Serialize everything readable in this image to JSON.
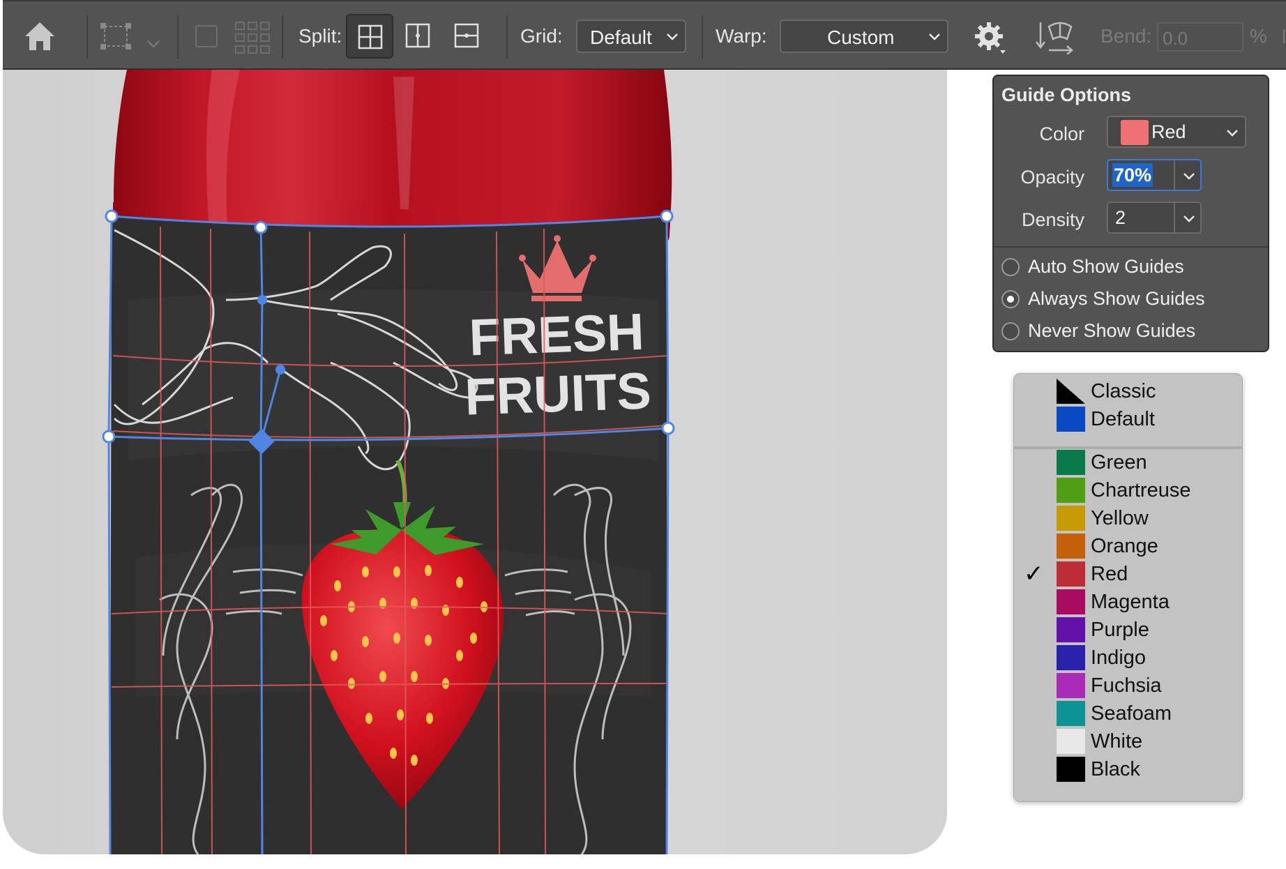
{
  "toolbar": {
    "split_label": "Split:",
    "grid_label": "Grid:",
    "grid_value": "Default",
    "warp_label": "Warp:",
    "warp_value": "Custom",
    "bend_label": "Bend:",
    "bend_value": "0.0",
    "bend_unit": "%",
    "icons": [
      "home-icon",
      "transform-icon",
      "chevron-down-icon",
      "square-icon",
      "grid-dots-icon",
      "split-crosswise-icon",
      "split-vertical-icon",
      "split-horizontal-icon",
      "gear-icon",
      "warp-orientation-icon"
    ]
  },
  "artwork": {
    "label_line1": "FRESH",
    "label_line2": "FRUITS"
  },
  "guide_options": {
    "title": "Guide Options",
    "color_label": "Color",
    "color_value": "Red",
    "color_swatch": "#f07173",
    "opacity_label": "Opacity",
    "opacity_value": "70%",
    "density_label": "Density",
    "density_value": "2",
    "radios": [
      {
        "label": "Auto Show Guides",
        "selected": false
      },
      {
        "label": "Always Show Guides",
        "selected": true
      },
      {
        "label": "Never Show Guides",
        "selected": false
      }
    ]
  },
  "color_menu": {
    "items": [
      {
        "label": "Classic",
        "color": "#000000"
      },
      {
        "label": "Default",
        "color": "#0a49c4"
      },
      {
        "label": "Green",
        "color": "#0a7a4c"
      },
      {
        "label": "Chartreuse",
        "color": "#4f9e14"
      },
      {
        "label": "Yellow",
        "color": "#c69a05"
      },
      {
        "label": "Orange",
        "color": "#c5600a"
      },
      {
        "label": "Red",
        "color": "#be2c35",
        "checked": true
      },
      {
        "label": "Magenta",
        "color": "#a80b5f"
      },
      {
        "label": "Purple",
        "color": "#6212a8"
      },
      {
        "label": "Indigo",
        "color": "#2a22ac"
      },
      {
        "label": "Fuchsia",
        "color": "#ac2ab8"
      },
      {
        "label": "Seafoam",
        "color": "#0d9395"
      },
      {
        "label": "White",
        "color": "#e8e8e8"
      },
      {
        "label": "Black",
        "color": "#000000"
      }
    ],
    "check_glyph": "✓"
  }
}
